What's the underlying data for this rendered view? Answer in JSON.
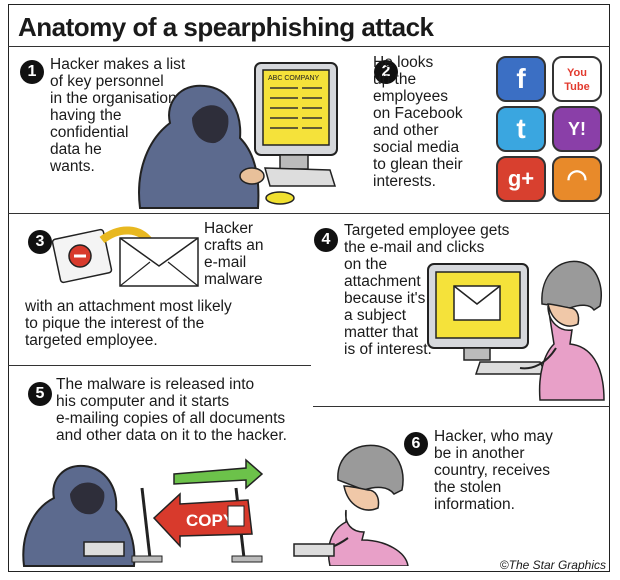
{
  "title": "Anatomy of a spearphishing attack",
  "steps": [
    {
      "number": "1",
      "text": "Hacker makes a list\nof key personnel\nin the organisation\nhaving the\nconfidential\ndata he\nwants."
    },
    {
      "number": "2",
      "text": "He looks\nup the\nemployees\non Facebook\nand other\nsocial media\nto glean their\ninterests."
    },
    {
      "number": "3",
      "text_a": "Hacker\ncrafts an\ne-mail\nmalware",
      "text_b": "with an attachment most likely\nto pique the interest of the\ntargeted employee."
    },
    {
      "number": "4",
      "text": "Targeted employee gets\nthe e-mail and clicks\non the\nattachment\nbecause it's\na subject\nmatter that\nis of interest."
    },
    {
      "number": "5",
      "text": "The malware is released into\nhis computer and it starts\ne-mailing copies of all documents\nand other data on it to the hacker."
    },
    {
      "number": "6",
      "text": "Hacker, who may\nbe in another\ncountry, receives\nthe stolen\ninformation."
    }
  ],
  "screen_label": "ABC COMPANY",
  "copy_label": "COPY",
  "social_icons": [
    {
      "name": "facebook-icon",
      "glyph": "f",
      "color": "#3b6fc4"
    },
    {
      "name": "youtube-icon",
      "glyph": "You\nTube",
      "color": "#e23a2e"
    },
    {
      "name": "twitter-icon",
      "glyph": "t",
      "color": "#3aa6e0"
    },
    {
      "name": "yahoo-icon",
      "glyph": "Y!",
      "color": "#8a3fa8"
    },
    {
      "name": "googleplus-icon",
      "glyph": "g+",
      "color": "#d8402f"
    },
    {
      "name": "rss-icon",
      "glyph": "◠",
      "color": "#e88a2a"
    }
  ],
  "credit": "©The Star Graphics",
  "colors": {
    "hoodie": "#5c6a8e",
    "screen_yellow": "#f5e23a",
    "arrow_green": "#6cc24a",
    "arrow_red": "#d83a2c",
    "shirt_pink": "#e8a0c8"
  }
}
